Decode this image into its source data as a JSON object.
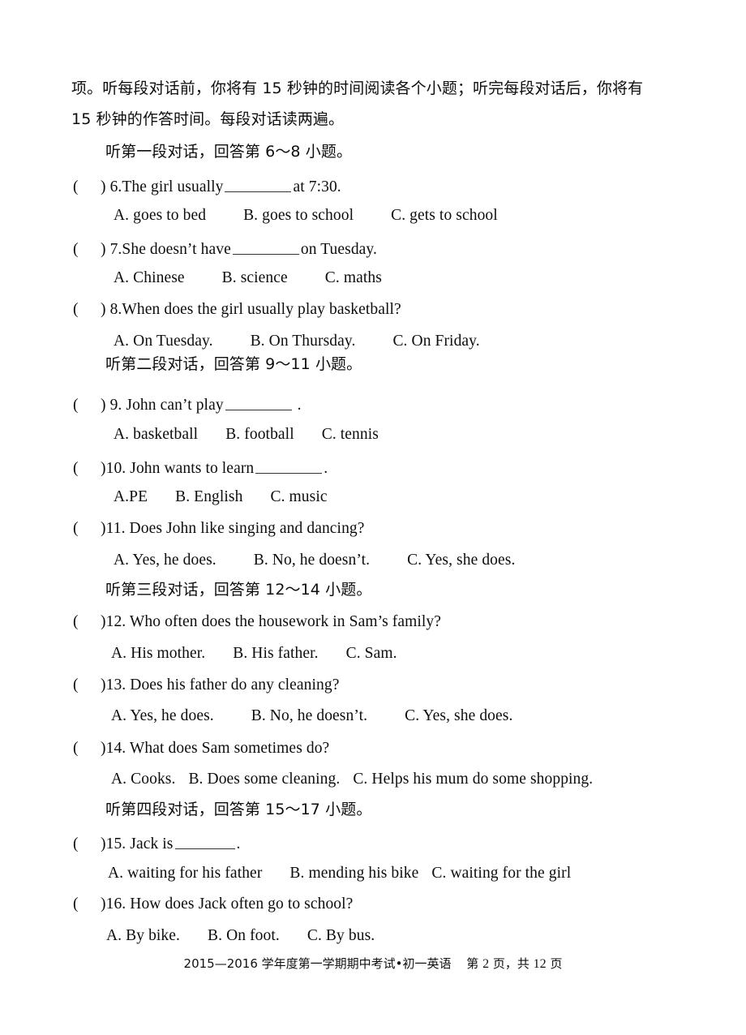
{
  "document": {
    "type": "exam-paper",
    "subject": "初一英语",
    "page_background": "#ffffff",
    "text_color": "#0d0d0d"
  },
  "intro": {
    "line1": "项。听每段对话前，你将有 15 秒钟的时间阅读各个小题；听完每段对话后，你将有",
    "line2": "15 秒钟的作答时间。每段对话读两遍。"
  },
  "sections": [
    {
      "id": "dialogue-1",
      "heading": "听第一段对话，回答第 6～8 小题。"
    },
    {
      "id": "dialogue-2",
      "heading": "听第二段对话，回答第 9～11 小题。"
    },
    {
      "id": "dialogue-3",
      "heading": "听第三段对话，回答第 12～14 小题。"
    },
    {
      "id": "dialogue-4",
      "heading": "听第四段对话，回答第 15～17 小题。"
    }
  ],
  "questions": [
    {
      "number": "6.",
      "stem_before": "The girl usually",
      "has_blank": true,
      "stem_after": "at 7:30.",
      "options": [
        "A. goes to bed",
        "B. goes to school",
        "C. gets to school"
      ]
    },
    {
      "number": "7.",
      "stem_before": "She doesn’t have",
      "has_blank": true,
      "stem_after": "on Tuesday.",
      "options": [
        "A. Chinese",
        "B. science",
        "C. maths"
      ]
    },
    {
      "number": "8.",
      "stem_before": "When does the girl usually play basketball?",
      "has_blank": false,
      "stem_after": "",
      "options": [
        "A. On Tuesday.",
        "B. On Thursday.",
        "C. On Friday."
      ]
    },
    {
      "number": "9.",
      "stem_before": "John can’t play",
      "has_blank": true,
      "stem_after": ".",
      "options": [
        "A. basketball",
        "B. football",
        "C. tennis"
      ]
    },
    {
      "number": "10.",
      "stem_before": "John wants to learn",
      "has_blank": true,
      "stem_after": ".",
      "options": [
        "A.PE",
        "B. English",
        "C. music"
      ]
    },
    {
      "number": "11.",
      "stem_before": "Does John like singing and dancing?",
      "has_blank": false,
      "stem_after": "",
      "options": [
        "A. Yes, he does.",
        "B. No, he doesn’t.",
        "C. Yes, she does."
      ]
    },
    {
      "number": "12.",
      "stem_before": "Who often does the housework in Sam’s family?",
      "has_blank": false,
      "stem_after": "",
      "options": [
        "A. His mother.",
        "B. His father.",
        "C. Sam."
      ]
    },
    {
      "number": "13.",
      "stem_before": "Does his father do any cleaning?",
      "has_blank": false,
      "stem_after": "",
      "options": [
        "A. Yes, he does.",
        "B. No, he doesn’t.",
        "C. Yes, she does."
      ]
    },
    {
      "number": "14.",
      "stem_before": "What does Sam sometimes do?",
      "has_blank": false,
      "stem_after": "",
      "options": [
        "A.  Cooks.",
        "B. Does some cleaning.",
        "C. Helps his mum do some shopping."
      ]
    },
    {
      "number": "15.",
      "stem_before": "Jack is",
      "has_blank": true,
      "stem_after": ".",
      "options": [
        "A. waiting for his father",
        "B. mending his bike",
        "C. waiting for the girl"
      ]
    },
    {
      "number": "16.",
      "stem_before": "How does Jack often go to school?",
      "has_blank": false,
      "stem_after": "",
      "options": [
        "A. By bike.",
        "B. On foot.",
        "C. By bus."
      ]
    }
  ],
  "footer": {
    "exam_title": "2015—2016 学年度第一学期期中考试•初一英语",
    "page_label_prefix": "第",
    "page_number": "2",
    "page_label_mid": "页，共",
    "total_pages": "12",
    "page_label_suffix": "页"
  }
}
